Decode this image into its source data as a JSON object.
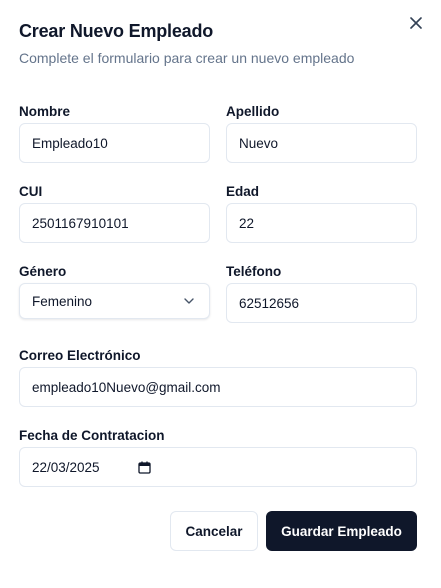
{
  "dialog": {
    "title": "Crear Nuevo Empleado",
    "subtitle": "Complete el formulario para crear un nuevo empleado",
    "close_icon": "close-icon"
  },
  "form": {
    "nombre": {
      "label": "Nombre",
      "value": "Empleado10"
    },
    "apellido": {
      "label": "Apellido",
      "value": "Nuevo"
    },
    "cui": {
      "label": "CUI",
      "value": "2501167910101"
    },
    "edad": {
      "label": "Edad",
      "value": "22"
    },
    "genero": {
      "label": "Género",
      "value": "Femenino",
      "icon": "chevron-down-icon"
    },
    "telefono": {
      "label": "Teléfono",
      "value": "62512656"
    },
    "correo": {
      "label": "Correo Electrónico",
      "value": "empleado10Nuevo@gmail.com"
    },
    "fecha": {
      "label": "Fecha de Contratacion",
      "value": "22/03/2025",
      "icon": "calendar-icon"
    }
  },
  "actions": {
    "cancel_label": "Cancelar",
    "save_label": "Guardar Empleado"
  },
  "colors": {
    "primary": "#0f172a",
    "muted_text": "#64748b",
    "border": "#e2e8f0"
  }
}
